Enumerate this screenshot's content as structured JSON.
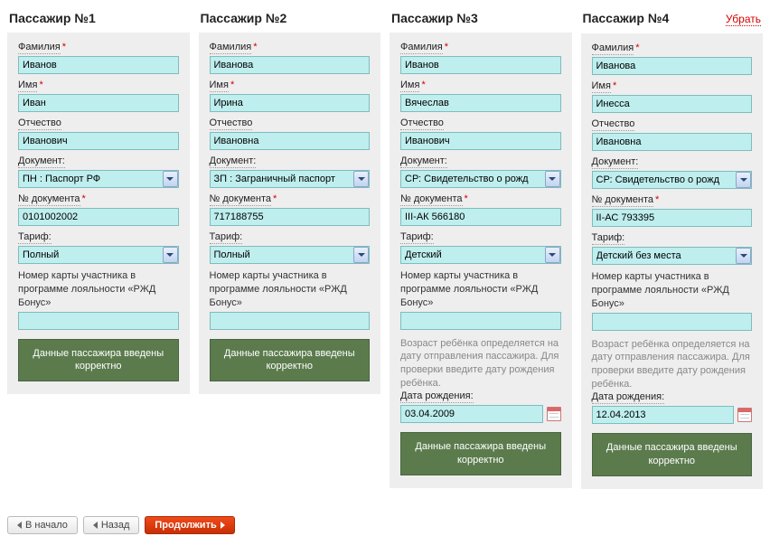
{
  "labels": {
    "surname": "Фамилия",
    "name": "Имя",
    "patronymic": "Отчество",
    "document": "Документ:",
    "doc_number": "№ документа",
    "tariff": "Тариф:",
    "loyalty": "Номер карты участника в программе лояльности «РЖД Бонус»",
    "confirm": "Данные пассажира введены корректно",
    "child_note": "Возраст ребёнка определяется на дату отправления пассажира. Для проверки введите дату рождения ребёнка.",
    "dob": "Дата рождения:",
    "remove": "Убрать"
  },
  "nav": {
    "start": "В начало",
    "back": "Назад",
    "continue": "Продолжить"
  },
  "passengers": [
    {
      "title": "Пассажир №1",
      "surname": "Иванов",
      "name": "Иван",
      "patronymic": "Иванович",
      "document": "ПН : Паспорт РФ",
      "doc_number": "0101002002",
      "tariff": "Полный",
      "loyalty": "",
      "is_child": false,
      "dob": "",
      "removable": false
    },
    {
      "title": "Пассажир №2",
      "surname": "Иванова",
      "name": "Ирина",
      "patronymic": "Ивановна",
      "document": "ЗП : Заграничный паспорт",
      "doc_number": "717188755",
      "tariff": "Полный",
      "loyalty": "",
      "is_child": false,
      "dob": "",
      "removable": false
    },
    {
      "title": "Пассажир №3",
      "surname": "Иванов",
      "name": "Вячеслав",
      "patronymic": "Иванович",
      "document": "СР: Свидетельство о рожд",
      "doc_number": "III-АК 566180",
      "tariff": "Детский",
      "loyalty": "",
      "is_child": true,
      "dob": "03.04.2009",
      "removable": false
    },
    {
      "title": "Пассажир №4",
      "surname": "Иванова",
      "name": "Инесса",
      "patronymic": "Ивановна",
      "document": "СР: Свидетельство о рожд",
      "doc_number": "II-АС 793395",
      "tariff": "Детский без места",
      "loyalty": "",
      "is_child": true,
      "dob": "12.04.2013",
      "removable": true
    }
  ]
}
